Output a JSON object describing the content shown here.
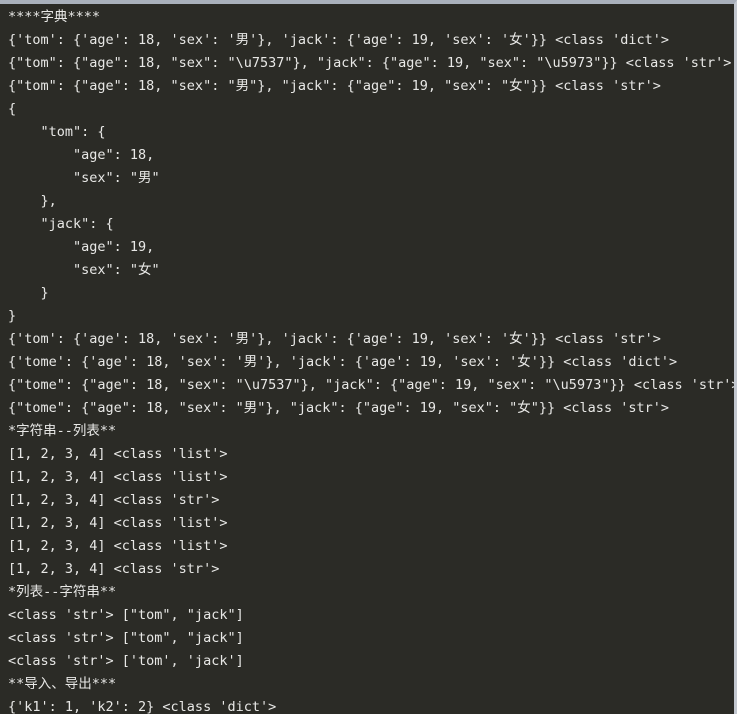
{
  "window": {
    "kind": "terminal-console-output",
    "background_color": "#2b2b26",
    "text_color": "#e8e8e6",
    "top_border_color": "#a9b0bb",
    "right_border_color": "#c3c8d0"
  },
  "console": {
    "lines": [
      "****字典****",
      "{'tom': {'age': 18, 'sex': '男'}, 'jack': {'age': 19, 'sex': '女'}} <class 'dict'>",
      "{\"tom\": {\"age\": 18, \"sex\": \"\\u7537\"}, \"jack\": {\"age\": 19, \"sex\": \"\\u5973\"}} <class 'str'>",
      "{\"tom\": {\"age\": 18, \"sex\": \"男\"}, \"jack\": {\"age\": 19, \"sex\": \"女\"}} <class 'str'>",
      "{",
      "    \"tom\": {",
      "        \"age\": 18,",
      "        \"sex\": \"男\"",
      "    },",
      "    \"jack\": {",
      "        \"age\": 19,",
      "        \"sex\": \"女\"",
      "    }",
      "}",
      "{'tom': {'age': 18, 'sex': '男'}, 'jack': {'age': 19, 'sex': '女'}} <class 'str'>",
      "{'tome': {'age': 18, 'sex': '男'}, 'jack': {'age': 19, 'sex': '女'}} <class 'dict'>",
      "{\"tome\": {\"age\": 18, \"sex\": \"\\u7537\"}, \"jack\": {\"age\": 19, \"sex\": \"\\u5973\"}} <class 'str'>",
      "{\"tome\": {\"age\": 18, \"sex\": \"男\"}, \"jack\": {\"age\": 19, \"sex\": \"女\"}} <class 'str'>",
      "*字符串--列表**",
      "[1, 2, 3, 4] <class 'list'>",
      "[1, 2, 3, 4] <class 'list'>",
      "[1, 2, 3, 4] <class 'str'>",
      "[1, 2, 3, 4] <class 'list'>",
      "[1, 2, 3, 4] <class 'list'>",
      "[1, 2, 3, 4] <class 'str'>",
      "*列表--字符串**",
      "<class 'str'> [\"tom\", \"jack\"]",
      "<class 'str'> [\"tom\", \"jack\"]",
      "<class 'str'> ['tom', 'jack']",
      "**导入、导出***",
      "{'k1': 1, 'k2': 2} <class 'dict'>"
    ]
  }
}
